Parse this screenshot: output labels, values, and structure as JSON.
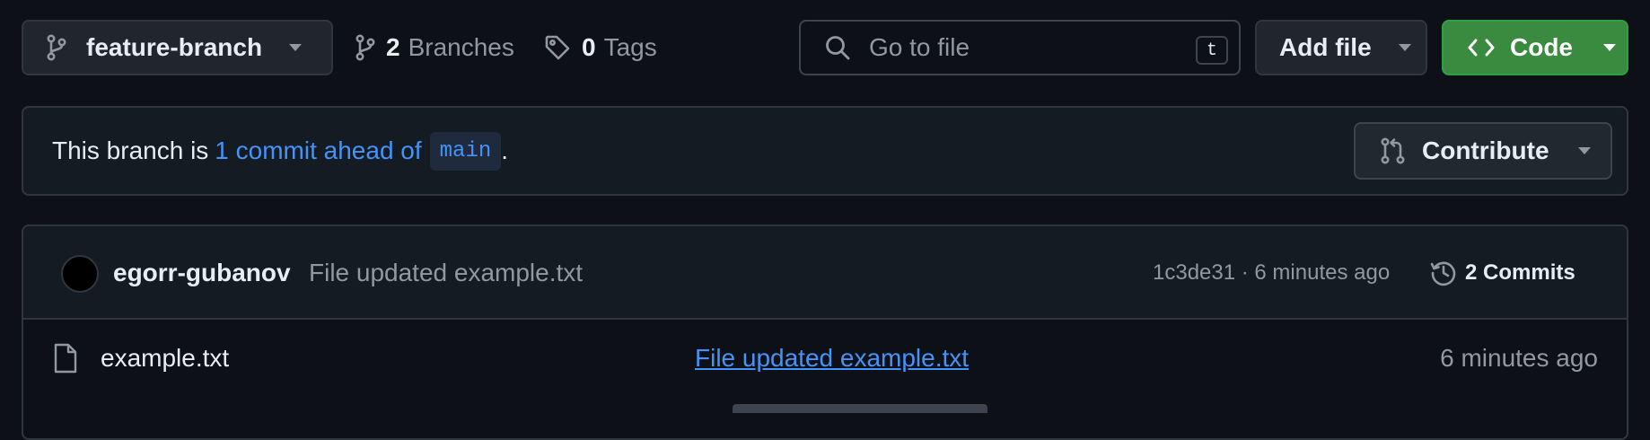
{
  "toolbar": {
    "branch_name": "feature-branch",
    "branches_count": "2",
    "branches_label": "Branches",
    "tags_count": "0",
    "tags_label": "Tags",
    "search_placeholder": "Go to file",
    "search_shortcut": "t",
    "add_file_label": "Add file",
    "code_label": "Code"
  },
  "banner": {
    "prefix": "This branch is",
    "ahead_link": "1 commit ahead of",
    "base_branch": "main",
    "suffix": ".",
    "contribute_label": "Contribute"
  },
  "latest_commit": {
    "author": "egorr-gubanov",
    "message": "File updated example.txt",
    "meta": "1c3de31 · 6 minutes ago",
    "commits_count_label": "2 Commits"
  },
  "files": [
    {
      "name": "example.txt",
      "last_commit_message": "File updated example.txt",
      "last_updated": "6 minutes ago"
    }
  ],
  "colors": {
    "background": "#0d1117",
    "link": "#4493f8",
    "code_button": "#3a8a3f",
    "muted_text": "#9198a1"
  },
  "icons": {
    "branch": "git-branch-icon",
    "tag": "tag-icon",
    "search": "search-icon",
    "code": "code-icon",
    "pull_request": "git-pull-request-icon",
    "history": "history-icon",
    "file": "file-icon"
  }
}
